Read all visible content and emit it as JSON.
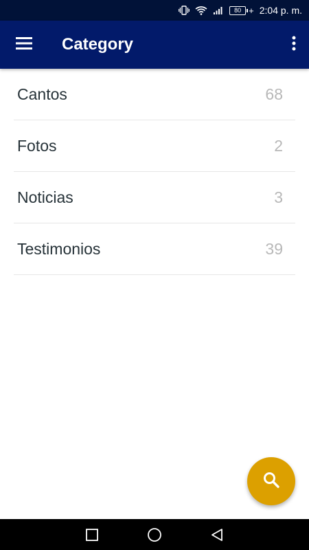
{
  "status_bar": {
    "battery_level": "80",
    "time": "2:04 p. m.",
    "icons": [
      "vibrate-icon",
      "wifi-icon",
      "signal-icon",
      "battery-icon",
      "charging-icon"
    ]
  },
  "app_bar": {
    "title": "Category",
    "background": "#021a6a"
  },
  "categories": [
    {
      "label": "Cantos",
      "count": "68"
    },
    {
      "label": "Fotos",
      "count": "2"
    },
    {
      "label": "Noticias",
      "count": "3"
    },
    {
      "label": "Testimonios",
      "count": "39"
    }
  ],
  "fab": {
    "icon": "search-icon",
    "color": "#dca000"
  },
  "nav_bar": {
    "buttons": [
      "recents-icon",
      "home-icon",
      "back-icon"
    ]
  }
}
